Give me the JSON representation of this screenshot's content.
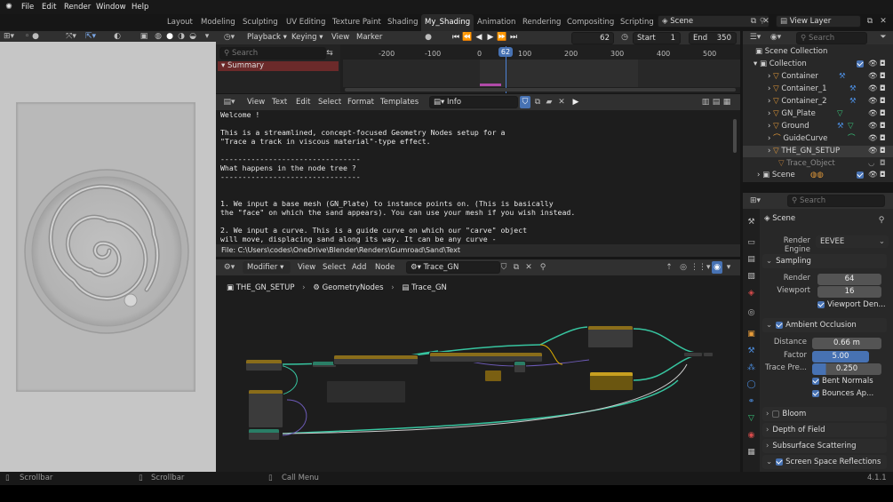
{
  "menu": {
    "items": [
      "File",
      "Edit",
      "Render",
      "Window",
      "Help"
    ]
  },
  "workspace_tabs": [
    "Layout",
    "Modeling",
    "Sculpting",
    "UV Editing",
    "Texture Paint",
    "Shading",
    "My_Shading",
    "Animation",
    "Rendering",
    "Compositing",
    "Scripting"
  ],
  "active_tab": "My_Shading",
  "scene": {
    "label": "Scene",
    "view_layer": "View Layer"
  },
  "timeline": {
    "playback": "Playback",
    "keying": "Keying",
    "view": "View",
    "marker": "Marker",
    "current_frame": "62",
    "start_label": "Start",
    "start": "1",
    "end_label": "End",
    "end": "350",
    "search_placeholder": "Search",
    "summary": "Summary",
    "ruler": [
      "-200",
      "-100",
      "0",
      "62",
      "100",
      "200",
      "300",
      "400",
      "500"
    ]
  },
  "text_editor": {
    "menus": [
      "View",
      "Text",
      "Edit",
      "Select",
      "Format",
      "Templates"
    ],
    "file_name": "Info",
    "lines": [
      "Welcome !",
      "",
      "This is a streamlined, concept-focused Geometry Nodes setup for a",
      "\"Trace a track in viscous material\"-type effect.",
      "",
      "--------------------------------",
      "What happens in the node tree ?",
      "--------------------------------",
      "",
      "",
      "1. We input a base mesh (GN_Plate) to instance points on. (This is basically",
      "the \"face\" on which the sand appears). You can use your mesh if you wish instead.",
      "",
      "2. We input a curve. This is a guide curve on which our \"carve\" object",
      "will move, displacing sand along its way. It can be any curve -"
    ],
    "file_path": "File: C:\\Users\\codes\\OneDrive\\Blender\\Renders\\Gumroad\\Sand\\Text"
  },
  "node_editor": {
    "modifier": "Modifier",
    "menus": [
      "View",
      "Select",
      "Add",
      "Node"
    ],
    "tree_name": "Trace_GN",
    "breadcrumb": [
      "THE_GN_SETUP",
      "GeometryNodes",
      "Trace_GN"
    ]
  },
  "outliner": {
    "search_placeholder": "Search",
    "scene_collection": "Scene Collection",
    "collection": "Collection",
    "items": [
      "Container",
      "Container_1",
      "Container_2",
      "GN_Plate",
      "Ground",
      "GuideCurve",
      "THE_GN_SETUP",
      "Trace_Object"
    ],
    "scene": "Scene"
  },
  "properties": {
    "search_placeholder": "Search",
    "scene": "Scene",
    "render_engine_label": "Render Engine",
    "render_engine": "EEVEE",
    "sampling": {
      "title": "Sampling",
      "render_label": "Render",
      "render": "64",
      "viewport_label": "Viewport",
      "viewport": "16",
      "viewport_denoise": "Viewport Den..."
    },
    "ao": {
      "title": "Ambient Occlusion",
      "distance_label": "Distance",
      "distance": "0.66 m",
      "factor_label": "Factor",
      "factor": "5.00",
      "trace_label": "Trace Pre...",
      "trace": "0.250",
      "bent_normals": "Bent Normals",
      "bounces": "Bounces Ap..."
    },
    "sections": [
      "Bloom",
      "Depth of Field",
      "Subsurface Scattering",
      "Screen Space Reflections"
    ]
  },
  "status": {
    "left": "Scrollbar",
    "mid": "Scrollbar",
    "call_menu": "Call Menu",
    "version": "4.1.1"
  }
}
